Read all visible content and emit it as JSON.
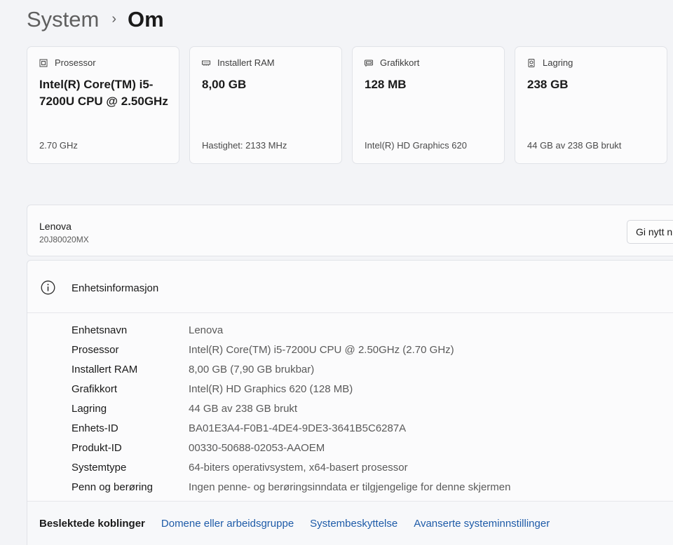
{
  "breadcrumb": {
    "parent": "System",
    "separator": "›",
    "current": "Om"
  },
  "cards": [
    {
      "icon": "processor-icon",
      "label": "Prosessor",
      "value": "Intel(R) Core(TM) i5-7200U CPU @ 2.50GHz",
      "foot": "2.70 GHz"
    },
    {
      "icon": "ram-icon",
      "label": "Installert RAM",
      "value": "8,00 GB",
      "foot": "Hastighet: 2133 MHz"
    },
    {
      "icon": "graphics-card-icon",
      "label": "Grafikkort",
      "value": "128 MB",
      "foot": "Intel(R) HD Graphics 620"
    },
    {
      "icon": "storage-icon",
      "label": "Lagring",
      "value": "238 GB",
      "foot": "44 GB av 238 GB brukt"
    }
  ],
  "device": {
    "name": "Lenova",
    "model": "20J80020MX",
    "rename_label": "Gi nytt n"
  },
  "device_info": {
    "title": "Enhetsinformasjon",
    "rows": [
      {
        "label": "Enhetsnavn",
        "value": "Lenova"
      },
      {
        "label": "Prosessor",
        "value": "Intel(R) Core(TM) i5-7200U CPU @ 2.50GHz (2.70 GHz)"
      },
      {
        "label": "Installert RAM",
        "value": "8,00 GB (7,90 GB brukbar)"
      },
      {
        "label": "Grafikkort",
        "value": "Intel(R) HD Graphics 620 (128 MB)"
      },
      {
        "label": "Lagring",
        "value": "44 GB av 238 GB brukt"
      },
      {
        "label": "Enhets-ID",
        "value": "BA01E3A4-F0B1-4DE4-9DE3-3641B5C6287A"
      },
      {
        "label": "Produkt-ID",
        "value": "00330-50688-02053-AAOEM"
      },
      {
        "label": "Systemtype",
        "value": "64-biters operativsystem, x64-basert prosessor"
      },
      {
        "label": "Penn og berøring",
        "value": "Ingen penne- og berøringsinndata er tilgjengelige for denne skjermen"
      }
    ]
  },
  "related": {
    "title": "Beslektede koblinger",
    "links": [
      "Domene eller arbeidsgruppe",
      "Systembeskyttelse",
      "Avanserte systeminnstillinger"
    ]
  },
  "colors": {
    "background": "#f3f4f7",
    "card": "#fbfbfc",
    "link": "#1e5ba8",
    "border": "#e1e3e8"
  }
}
